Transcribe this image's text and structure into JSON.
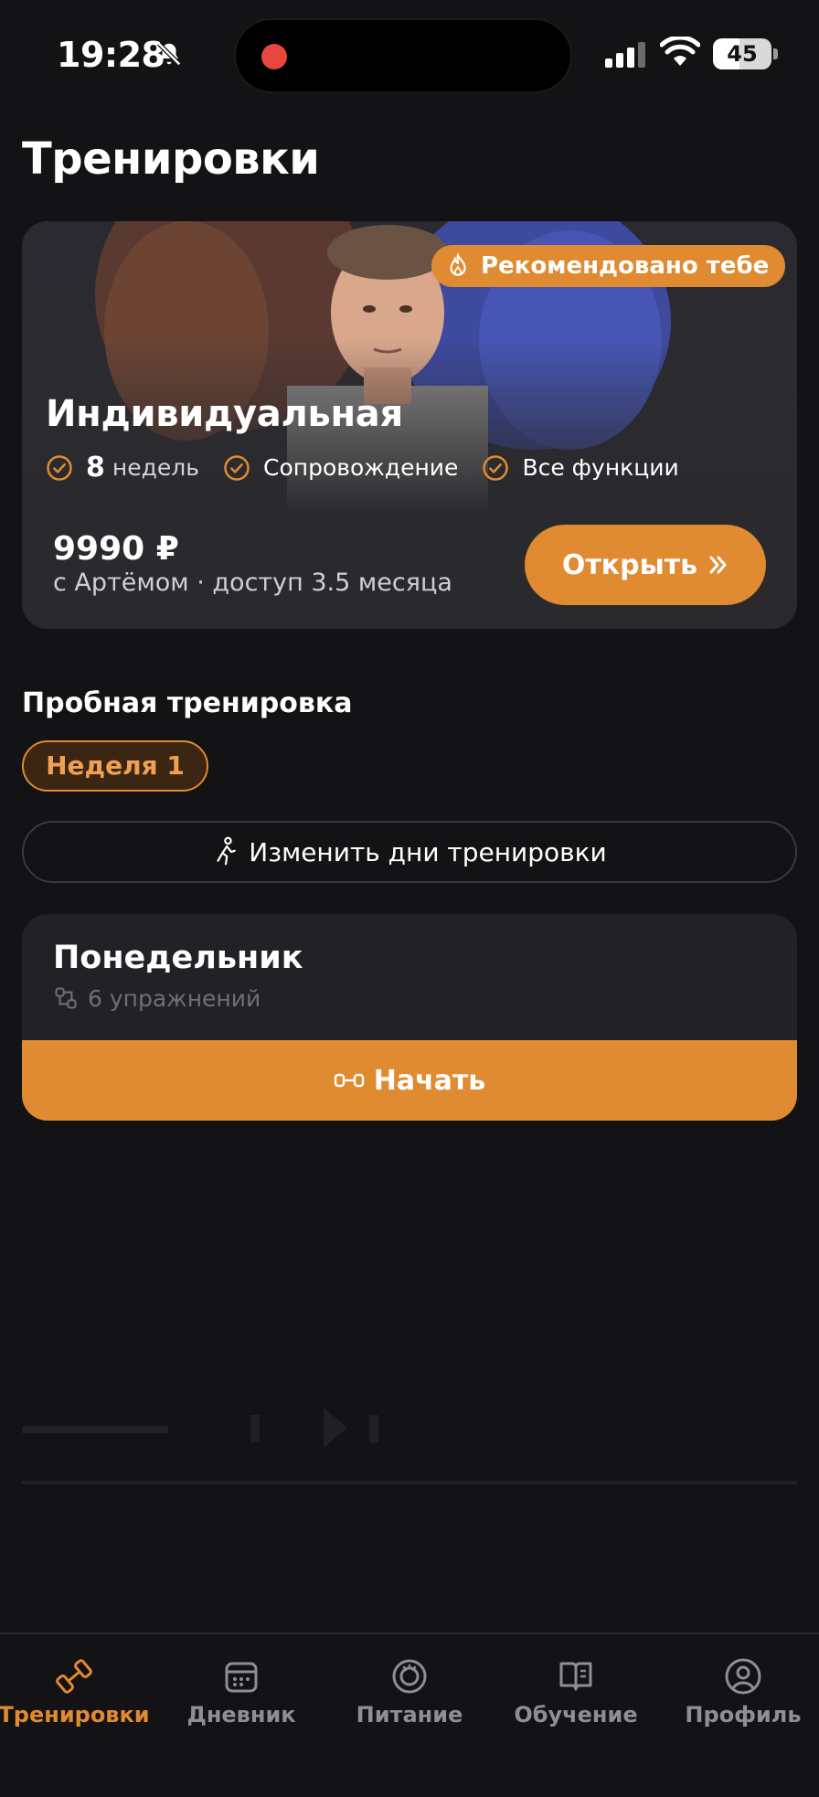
{
  "status_bar": {
    "time": "19:28",
    "battery": "45",
    "battery_level_percent": 45
  },
  "page_title": "Тренировки",
  "hero": {
    "badge": "Рекомендовано тебе",
    "title": "Индивидуальная",
    "features": [
      {
        "value": "8",
        "label": "недель"
      },
      {
        "label": "Сопровождение"
      },
      {
        "label": "Все функции"
      }
    ],
    "price": "9990 ₽",
    "price_subtitle": "с Артёмом · доступ 3.5 месяца",
    "open_label": "Открыть"
  },
  "trial": {
    "section_title": "Пробная тренировка",
    "week_chip": "Неделя 1",
    "change_days_label": "Изменить дни тренировки"
  },
  "day_card": {
    "day": "Понедельник",
    "exercises": "6 упражнений",
    "start_label": "Начать"
  },
  "tabbar": {
    "tabs": [
      {
        "label": "Тренировки",
        "icon": "dumbbell-icon",
        "active": true
      },
      {
        "label": "Дневник",
        "icon": "calendar-icon",
        "active": false
      },
      {
        "label": "Питание",
        "icon": "plate-icon",
        "active": false
      },
      {
        "label": "Обучение",
        "icon": "book-icon",
        "active": false
      },
      {
        "label": "Профиль",
        "icon": "profile-icon",
        "active": false
      }
    ]
  },
  "colors": {
    "accent": "#e08a31",
    "background": "#131214",
    "card": "#2a2a2e"
  }
}
